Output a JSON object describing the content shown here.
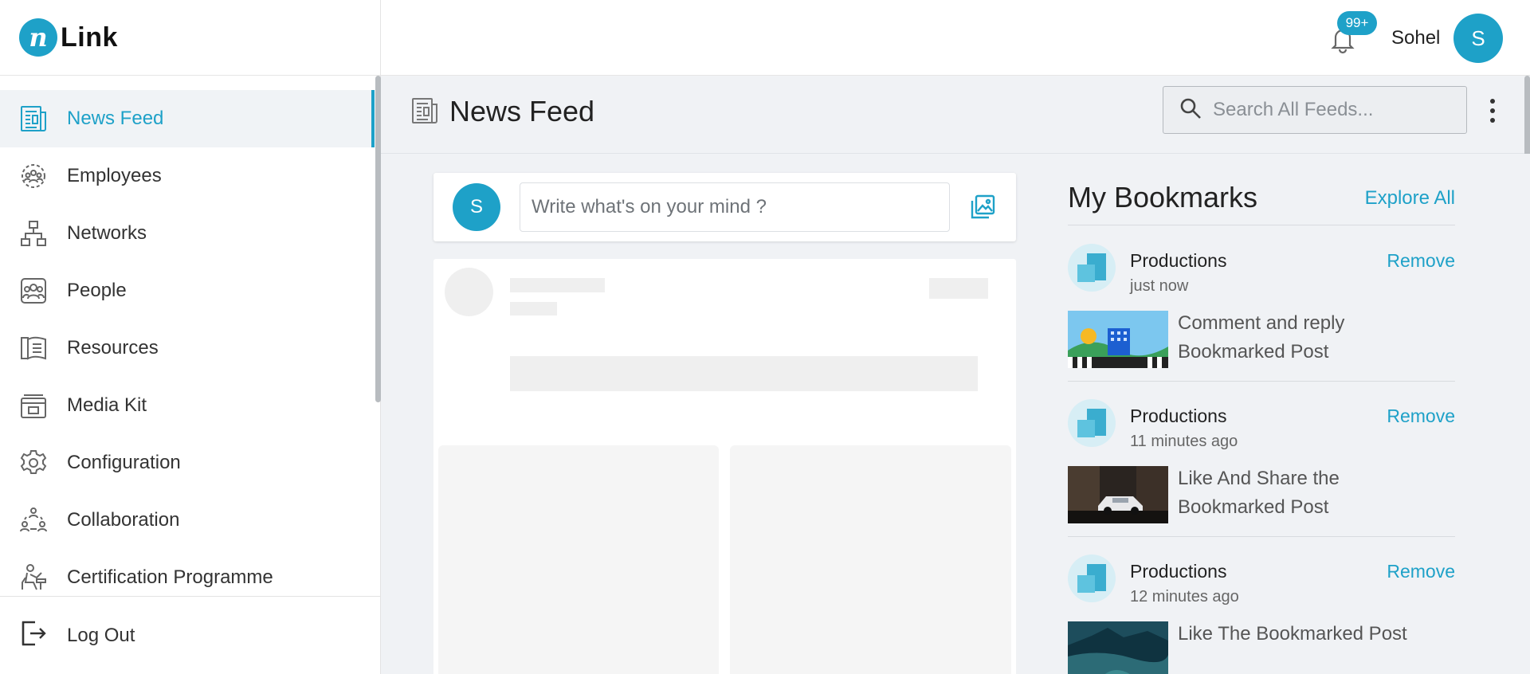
{
  "brand": {
    "mark": "n",
    "name": "Link"
  },
  "sidebar": {
    "items": [
      {
        "label": "News Feed",
        "icon": "news-feed-icon",
        "active": true
      },
      {
        "label": "Employees",
        "icon": "employees-icon"
      },
      {
        "label": "Networks",
        "icon": "networks-icon"
      },
      {
        "label": "People",
        "icon": "people-icon"
      },
      {
        "label": "Resources",
        "icon": "resources-icon"
      },
      {
        "label": "Media Kit",
        "icon": "media-kit-icon"
      },
      {
        "label": "Configuration",
        "icon": "gear-icon"
      },
      {
        "label": "Collaboration",
        "icon": "collaboration-icon"
      },
      {
        "label": "Certification Programme",
        "icon": "certification-icon"
      }
    ],
    "logout_label": "Log Out"
  },
  "header": {
    "notifications_badge": "99+",
    "user_name": "Sohel",
    "user_initial": "S"
  },
  "page": {
    "title": "News Feed",
    "search_placeholder": "Search All Feeds..."
  },
  "composer": {
    "avatar_initial": "S",
    "placeholder": "Write what's on your mind ?"
  },
  "bookmarks": {
    "title": "My Bookmarks",
    "explore_label": "Explore All",
    "items": [
      {
        "author": "Productions",
        "time": "just now",
        "remove_label": "Remove",
        "text": "Comment and reply Bookmarked Post",
        "thumb": "psd-illustration"
      },
      {
        "author": "Productions",
        "time": "11 minutes ago",
        "remove_label": "Remove",
        "text": "Like And Share the Bookmarked Post",
        "thumb": "car-photo"
      },
      {
        "author": "Productions",
        "time": "12 minutes ago",
        "remove_label": "Remove",
        "text": "Like The Bookmarked Post",
        "thumb": "landscape-photo"
      }
    ]
  },
  "colors": {
    "accent": "#1ea1c8",
    "background": "#f0f2f5"
  }
}
